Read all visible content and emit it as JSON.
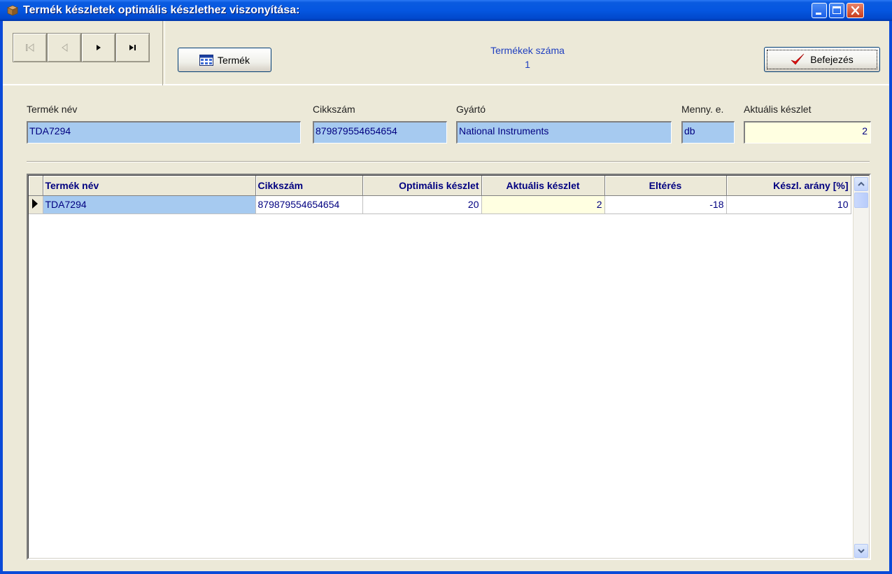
{
  "window": {
    "title": "Termék készletek optimális készlethez viszonyítása:"
  },
  "toolbar": {
    "nav_buttons": [
      "first-record",
      "previous-record",
      "next-record",
      "last-record"
    ],
    "termek_label": "Termék",
    "befejezes_label": "Befejezés",
    "count_label": "Termékek száma",
    "count_value": "1"
  },
  "fields": {
    "termek_nev": {
      "label": "Termék név",
      "value": "TDA7294"
    },
    "cikkszam": {
      "label": "Cikkszám",
      "value": "879879554654654"
    },
    "gyarto": {
      "label": "Gyártó",
      "value": "National Instruments"
    },
    "menny": {
      "label": "Menny. e.",
      "value": "db"
    },
    "aktualis": {
      "label": "Aktuális készlet",
      "value": "2"
    }
  },
  "grid": {
    "columns": [
      "Termék név",
      "Cikkszám",
      "Optimális készlet",
      "Aktuális készlet",
      "Eltérés",
      "Készl. arány [%]"
    ],
    "rows": [
      [
        "TDA7294",
        "879879554654654",
        "20",
        "2",
        "-18",
        "10"
      ]
    ]
  },
  "colors": {
    "title_bar": "#0556e0",
    "selected_field": "#a6caf0",
    "highlight_field": "#ffffe1",
    "text_blue": "#000080"
  }
}
